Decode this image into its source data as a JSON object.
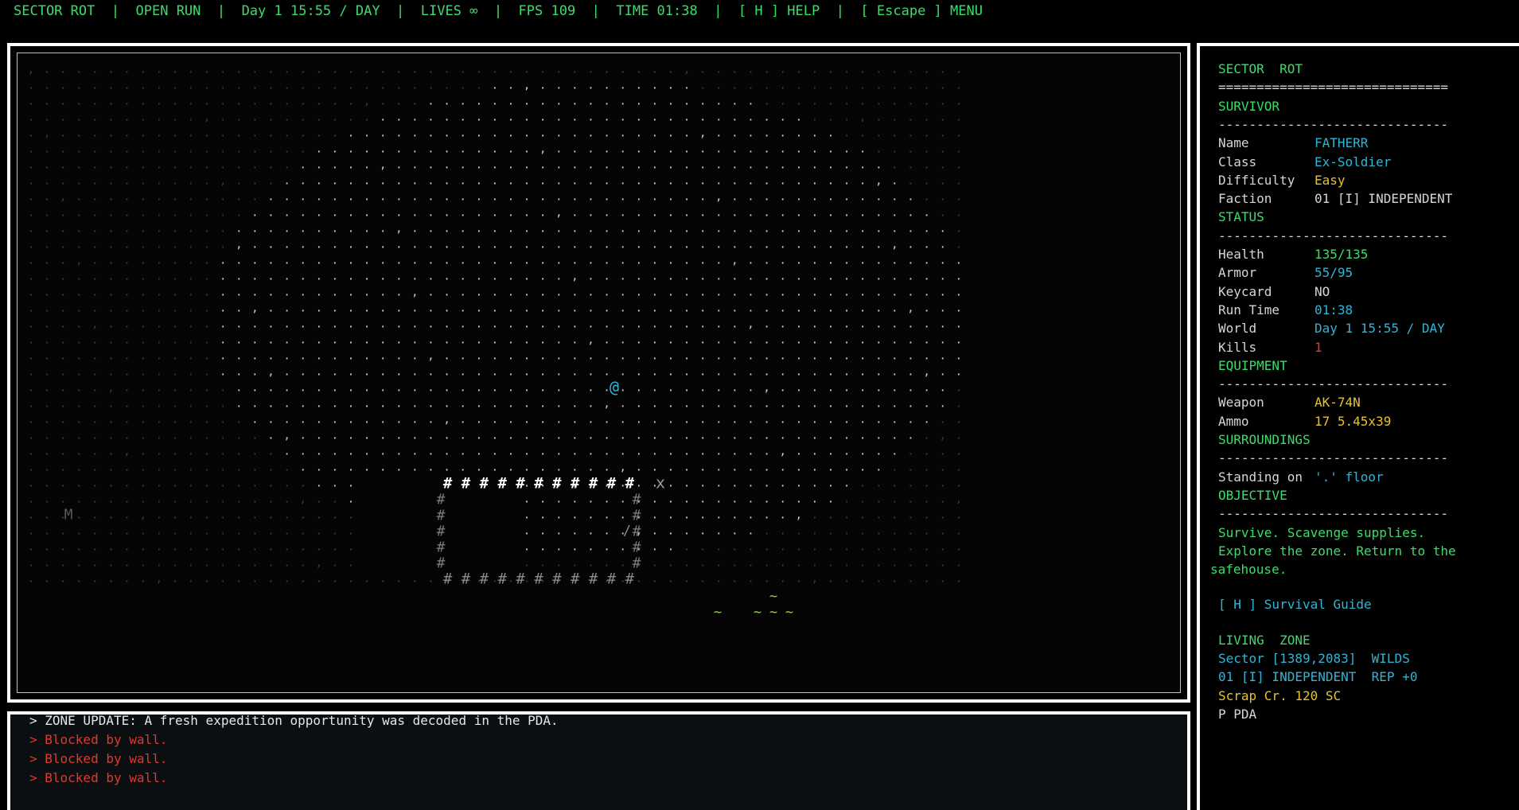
{
  "top_bar": {
    "text": "SECTOR ROT  |  OPEN RUN  |  Day 1 15:55 / DAY  |  LIVES ∞  |  FPS 109  |  TIME 01:38  |  [ H ] HELP  |  [ Escape ] MENU"
  },
  "map": {
    "player": "@",
    "player_color": "#2fb5d6",
    "marker_x": "x",
    "marker_m": "M",
    "wall_top": "# # # # # # # # # # #",
    "wall_bottom": "# # # # # # # # # # #",
    "door": "/",
    "floor_color": "#cfcfcf",
    "dim_color": "#3a3a3a",
    "water_color": "#8fd431"
  },
  "log": {
    "lines": [
      {
        "text": "> ZONE UPDATE: A fresh expedition opportunity was decoded in the PDA.",
        "color": "#e6e6e6"
      },
      {
        "text": "> Blocked by wall.",
        "color": "#e0392b"
      },
      {
        "text": "> Blocked by wall.",
        "color": "#e0392b"
      },
      {
        "text": "> Blocked by wall.",
        "color": "#e0392b"
      }
    ]
  },
  "side": {
    "title": "SECTOR  ROT",
    "double_rule": "==============================",
    "rule": "------------------------------",
    "survivor_header": "SURVIVOR",
    "survivor": [
      {
        "label": "Name",
        "value": "FATHERR",
        "color": "#2fb5d6"
      },
      {
        "label": "Class",
        "value": "Ex-Soldier",
        "color": "#2fb5d6"
      },
      {
        "label": "Difficulty",
        "value": "Easy",
        "color": "#e8c22c"
      },
      {
        "label": "Faction",
        "value": "01 [I] INDEPENDENT",
        "color": "#d6d6d6"
      }
    ],
    "status_header": "STATUS",
    "status": [
      {
        "label": "Health",
        "value": "135/135",
        "color": "#3ddc6a"
      },
      {
        "label": "Armor",
        "value": "55/95",
        "color": "#2fb5d6"
      },
      {
        "label": "Keycard",
        "value": "NO",
        "color": "#d6d6d6"
      },
      {
        "label": "Run Time",
        "value": "01:38",
        "color": "#2fb5d6"
      },
      {
        "label": "World",
        "value": "Day 1 15:55 / DAY",
        "color": "#2fb5d6"
      },
      {
        "label": "Kills",
        "value": "1",
        "color": "#e0392b"
      }
    ],
    "equipment_header": "EQUIPMENT",
    "equipment": [
      {
        "label": "Weapon",
        "value": "AK-74N",
        "color": "#e8c22c"
      },
      {
        "label": "Ammo",
        "value": "17 5.45x39",
        "color": "#e8c22c"
      }
    ],
    "surroundings_header": "SURROUNDINGS",
    "standing_label": "Standing on",
    "standing_value": "'.' floor",
    "objective_header": "OBJECTIVE",
    "objective_lines": [
      "Survive. Scavenge supplies.",
      "Explore the zone. Return to the",
      "safehouse."
    ],
    "guide_link": "[ H ] Survival Guide",
    "zone_header": "LIVING  ZONE",
    "sector_line": "Sector [1389,2083]  WILDS",
    "faction_line": "01 [I] INDEPENDENT  REP +0",
    "scrap_line": "Scrap Cr. 120 SC",
    "pda_line": "P PDA",
    "colors": {
      "header": "#3ddc6a",
      "label": "#d6d6d6",
      "rule": "#d6d6d6",
      "cyan": "#2fb5d6",
      "yellow": "#e8c22c",
      "green": "#3ddc6a"
    }
  }
}
